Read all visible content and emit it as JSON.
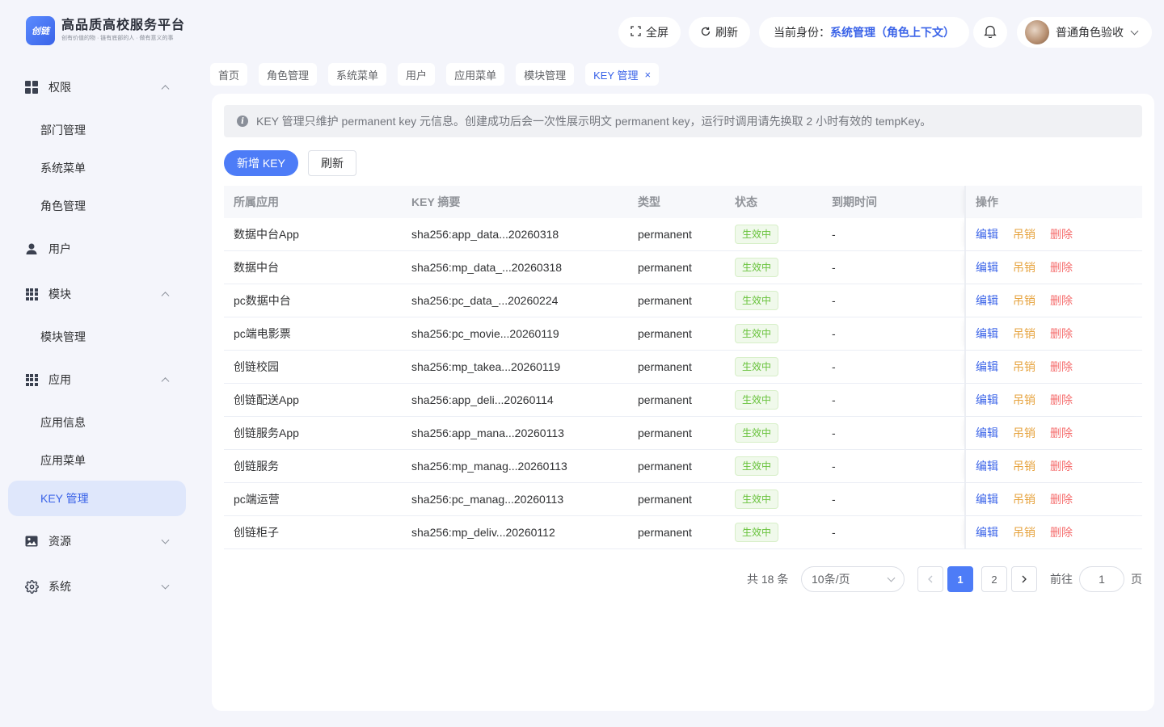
{
  "brand": {
    "logo_text": "创链",
    "title": "高品质高校服务平台",
    "subtitle": "创有价值的物 · 链有底部的人 · 做有意义的事"
  },
  "sidebar": {
    "groups": [
      {
        "label": "权限",
        "icon": "grid-icon",
        "expanded": true,
        "items": [
          {
            "label": "部门管理"
          },
          {
            "label": "系统菜单"
          },
          {
            "label": "角色管理"
          }
        ]
      },
      {
        "label": "用户",
        "icon": "user-icon",
        "expanded": false,
        "items": []
      },
      {
        "label": "模块",
        "icon": "apps-icon",
        "expanded": true,
        "items": [
          {
            "label": "模块管理"
          }
        ]
      },
      {
        "label": "应用",
        "icon": "apps-icon",
        "expanded": true,
        "items": [
          {
            "label": "应用信息"
          },
          {
            "label": "应用菜单"
          },
          {
            "label": "KEY 管理",
            "active": true
          }
        ]
      },
      {
        "label": "资源",
        "icon": "image-icon",
        "expanded": false,
        "items": []
      },
      {
        "label": "系统",
        "icon": "gear-icon",
        "expanded": false,
        "items": []
      }
    ]
  },
  "header": {
    "fullscreen_label": "全屏",
    "refresh_label": "刷新",
    "role_label": "当前身份：",
    "role_value": "系统管理（角色上下文）",
    "user_name": "普通角色验收"
  },
  "tabs": [
    {
      "label": "首页"
    },
    {
      "label": "角色管理"
    },
    {
      "label": "系统菜单"
    },
    {
      "label": "用户"
    },
    {
      "label": "应用菜单"
    },
    {
      "label": "模块管理"
    },
    {
      "label": "KEY 管理",
      "active": true,
      "close": "×"
    }
  ],
  "main": {
    "alert_text": "KEY 管理只维护 permanent key 元信息。创建成功后会一次性展示明文 permanent key，运行时调用请先换取 2 小时有效的 tempKey。",
    "add_button": "新增 KEY",
    "refresh_button": "刷新",
    "columns": [
      "所属应用",
      "KEY 摘要",
      "类型",
      "状态",
      "到期时间",
      "操作"
    ],
    "actions": {
      "edit": "编辑",
      "revoke": "吊销",
      "delete": "删除"
    },
    "rows": [
      {
        "app": "数据中台App",
        "key": "sha256:app_data...20260318",
        "type": "permanent",
        "status": "生效中",
        "expire": "-"
      },
      {
        "app": "数据中台",
        "key": "sha256:mp_data_...20260318",
        "type": "permanent",
        "status": "生效中",
        "expire": "-"
      },
      {
        "app": "pc数据中台",
        "key": "sha256:pc_data_...20260224",
        "type": "permanent",
        "status": "生效中",
        "expire": "-"
      },
      {
        "app": "pc端电影票",
        "key": "sha256:pc_movie...20260119",
        "type": "permanent",
        "status": "生效中",
        "expire": "-"
      },
      {
        "app": "创链校园",
        "key": "sha256:mp_takea...20260119",
        "type": "permanent",
        "status": "生效中",
        "expire": "-"
      },
      {
        "app": "创链配送App",
        "key": "sha256:app_deli...20260114",
        "type": "permanent",
        "status": "生效中",
        "expire": "-"
      },
      {
        "app": "创链服务App",
        "key": "sha256:app_mana...20260113",
        "type": "permanent",
        "status": "生效中",
        "expire": "-"
      },
      {
        "app": "创链服务",
        "key": "sha256:mp_manag...20260113",
        "type": "permanent",
        "status": "生效中",
        "expire": "-"
      },
      {
        "app": "pc端运营",
        "key": "sha256:pc_manag...20260113",
        "type": "permanent",
        "status": "生效中",
        "expire": "-"
      },
      {
        "app": "创链柜子",
        "key": "sha256:mp_deliv...20260112",
        "type": "permanent",
        "status": "生效中",
        "expire": "-"
      }
    ]
  },
  "pagination": {
    "total_text": "共 18 条",
    "page_size": "10条/页",
    "pages": [
      "1",
      "2"
    ],
    "current_page": "1",
    "goto_label": "前往",
    "goto_value": "1",
    "page_suffix": "页"
  },
  "colors": {
    "primary": "#4d7cf7",
    "active_bg": "#dfe7fb",
    "success": "#67c23a",
    "warning": "#e6a23c",
    "danger": "#f56c6c",
    "background": "#f4f5fb"
  }
}
